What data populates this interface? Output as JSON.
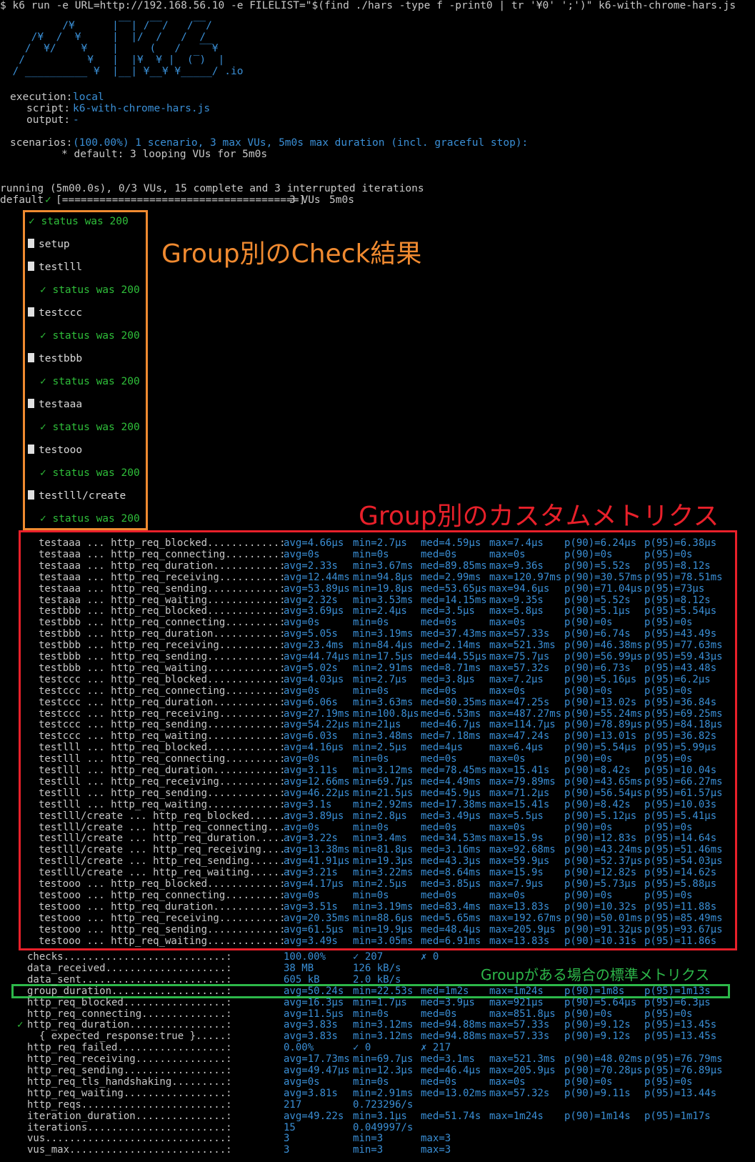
{
  "command": "$ k6 run -e URL=http://192.168.56.10 -e FILELIST=\"$(find ./hars -type f -print0 | tr '¥0' ';')\" k6-with-chrome-hars.js",
  "logo": [
    "          /¥      |‾‾| /‾‾/   /‾‾/",
    "     /¥  /  ¥     |  |/  /   /  /",
    "    /  ¥/    ¥    |     (   /   ‾‾¥",
    "   /          ¥   |  |¥  ¥ |  (‾)  |",
    "  / __________ ¥  |__| ¥__¥ ¥_____/ .io"
  ],
  "execution": {
    "label": "execution:",
    "value": "local"
  },
  "script": {
    "label": "script:",
    "value": "k6-with-chrome-hars.js"
  },
  "output": {
    "label": "output:",
    "value": "-"
  },
  "scenarios": {
    "label": "scenarios:",
    "value": "(100.00%) 1 scenario, 3 max VUs, 5m0s max duration (incl. graceful stop):",
    "detail": "* default: 3 looping VUs for 5m0s"
  },
  "running": "running (5m00.0s), 0/3 VUs, 15 complete and 3 interrupted iterations",
  "progress": {
    "name": "default",
    "check": "✓",
    "bar": "[======================================]",
    "vus": "3 VUs",
    "time": "5m0s"
  },
  "groups": [
    {
      "type": "check",
      "text": "✓ status was 200"
    },
    {
      "type": "group",
      "text": "setup"
    },
    {
      "type": "group",
      "text": "testlll"
    },
    {
      "type": "check",
      "text": "✓ status was 200"
    },
    {
      "type": "group",
      "text": "testccc"
    },
    {
      "type": "check",
      "text": "✓ status was 200"
    },
    {
      "type": "group",
      "text": "testbbb"
    },
    {
      "type": "check",
      "text": "✓ status was 200"
    },
    {
      "type": "group",
      "text": "testaaa"
    },
    {
      "type": "check",
      "text": "✓ status was 200"
    },
    {
      "type": "group",
      "text": "testooo"
    },
    {
      "type": "check",
      "text": "✓ status was 200"
    },
    {
      "type": "group",
      "text": "testlll/create"
    },
    {
      "type": "check",
      "text": "✓ status was 200"
    }
  ],
  "annotations": {
    "checks": {
      "text": "Group別のCheck結果",
      "color": "#f08a30"
    },
    "custom": {
      "text": "Group別のカスタムメトリクス",
      "color": "#e8202a"
    },
    "standard": {
      "text": "Groupがある場合の標準メトリクス",
      "color": "#2db84a"
    }
  },
  "custom_metrics": [
    {
      "name": "testaaa ... http_req_blocked............:",
      "avg": "avg=4.66µs",
      "min": "min=2.7µs",
      "med": "med=4.59µs",
      "max": "max=7.4µs",
      "p90": "p(90)=6.24µs",
      "p95": "p(95)=6.38µs"
    },
    {
      "name": "testaaa ... http_req_connecting.........:",
      "avg": "avg=0s",
      "min": "min=0s",
      "med": "med=0s",
      "max": "max=0s",
      "p90": "p(90)=0s",
      "p95": "p(95)=0s"
    },
    {
      "name": "testaaa ... http_req_duration...........:",
      "avg": "avg=2.33s",
      "min": "min=3.67ms",
      "med": "med=89.85ms",
      "max": "max=9.36s",
      "p90": "p(90)=5.52s",
      "p95": "p(95)=8.12s"
    },
    {
      "name": "testaaa ... http_req_receiving..........:",
      "avg": "avg=12.44ms",
      "min": "min=94.8µs",
      "med": "med=2.99ms",
      "max": "max=120.97ms",
      "p90": "p(90)=30.57ms",
      "p95": "p(95)=78.51ms"
    },
    {
      "name": "testaaa ... http_req_sending............:",
      "avg": "avg=53.89µs",
      "min": "min=19.8µs",
      "med": "med=53.65µs",
      "max": "max=94.6µs",
      "p90": "p(90)=71.04µs",
      "p95": "p(95)=73µs"
    },
    {
      "name": "testaaa ... http_req_waiting............:",
      "avg": "avg=2.32s",
      "min": "min=3.53ms",
      "med": "med=14.15ms",
      "max": "max=9.35s",
      "p90": "p(90)=5.52s",
      "p95": "p(95)=8.12s"
    },
    {
      "name": "testbbb ... http_req_blocked............:",
      "avg": "avg=3.69µs",
      "min": "min=2.4µs",
      "med": "med=3.5µs",
      "max": "max=5.8µs",
      "p90": "p(90)=5.1µs",
      "p95": "p(95)=5.54µs"
    },
    {
      "name": "testbbb ... http_req_connecting.........:",
      "avg": "avg=0s",
      "min": "min=0s",
      "med": "med=0s",
      "max": "max=0s",
      "p90": "p(90)=0s",
      "p95": "p(95)=0s"
    },
    {
      "name": "testbbb ... http_req_duration...........:",
      "avg": "avg=5.05s",
      "min": "min=3.19ms",
      "med": "med=37.43ms",
      "max": "max=57.33s",
      "p90": "p(90)=6.74s",
      "p95": "p(95)=43.49s"
    },
    {
      "name": "testbbb ... http_req_receiving..........:",
      "avg": "avg=23.4ms",
      "min": "min=84.4µs",
      "med": "med=2.14ms",
      "max": "max=521.3ms",
      "p90": "p(90)=46.38ms",
      "p95": "p(95)=77.63ms"
    },
    {
      "name": "testbbb ... http_req_sending............:",
      "avg": "avg=44.74µs",
      "min": "min=17.5µs",
      "med": "med=44.55µs",
      "max": "max=75.7µs",
      "p90": "p(90)=56.99µs",
      "p95": "p(95)=59.43µs"
    },
    {
      "name": "testbbb ... http_req_waiting............:",
      "avg": "avg=5.02s",
      "min": "min=2.91ms",
      "med": "med=8.71ms",
      "max": "max=57.32s",
      "p90": "p(90)=6.73s",
      "p95": "p(95)=43.48s"
    },
    {
      "name": "testccc ... http_req_blocked............:",
      "avg": "avg=4.03µs",
      "min": "min=2.7µs",
      "med": "med=3.8µs",
      "max": "max=7.2µs",
      "p90": "p(90)=5.16µs",
      "p95": "p(95)=6.2µs"
    },
    {
      "name": "testccc ... http_req_connecting.........:",
      "avg": "avg=0s",
      "min": "min=0s",
      "med": "med=0s",
      "max": "max=0s",
      "p90": "p(90)=0s",
      "p95": "p(95)=0s"
    },
    {
      "name": "testccc ... http_req_duration...........:",
      "avg": "avg=6.06s",
      "min": "min=3.63ms",
      "med": "med=80.35ms",
      "max": "max=47.25s",
      "p90": "p(90)=13.02s",
      "p95": "p(95)=36.84s"
    },
    {
      "name": "testccc ... http_req_receiving..........:",
      "avg": "avg=27.19ms",
      "min": "min=100.8µs",
      "med": "med=6.53ms",
      "max": "max=487.27ms",
      "p90": "p(90)=55.24ms",
      "p95": "p(95)=69.25ms"
    },
    {
      "name": "testccc ... http_req_sending............:",
      "avg": "avg=54.22µs",
      "min": "min=21µs",
      "med": "med=46.7µs",
      "max": "max=114.7µs",
      "p90": "p(90)=78.89µs",
      "p95": "p(95)=84.18µs"
    },
    {
      "name": "testccc ... http_req_waiting............:",
      "avg": "avg=6.03s",
      "min": "min=3.48ms",
      "med": "med=7.18ms",
      "max": "max=47.24s",
      "p90": "p(90)=13.01s",
      "p95": "p(95)=36.82s"
    },
    {
      "name": "testlll ... http_req_blocked............:",
      "avg": "avg=4.16µs",
      "min": "min=2.5µs",
      "med": "med=4µs",
      "max": "max=6.4µs",
      "p90": "p(90)=5.54µs",
      "p95": "p(95)=5.99µs"
    },
    {
      "name": "testlll ... http_req_connecting.........:",
      "avg": "avg=0s",
      "min": "min=0s",
      "med": "med=0s",
      "max": "max=0s",
      "p90": "p(90)=0s",
      "p95": "p(95)=0s"
    },
    {
      "name": "testlll ... http_req_duration...........:",
      "avg": "avg=3.11s",
      "min": "min=3.12ms",
      "med": "med=78.45ms",
      "max": "max=15.41s",
      "p90": "p(90)=8.42s",
      "p95": "p(95)=10.04s"
    },
    {
      "name": "testlll ... http_req_receiving..........:",
      "avg": "avg=12.66ms",
      "min": "min=69.7µs",
      "med": "med=4.49ms",
      "max": "max=79.89ms",
      "p90": "p(90)=43.65ms",
      "p95": "p(95)=66.27ms"
    },
    {
      "name": "testlll ... http_req_sending............:",
      "avg": "avg=46.22µs",
      "min": "min=21.5µs",
      "med": "med=45.9µs",
      "max": "max=71.2µs",
      "p90": "p(90)=56.54µs",
      "p95": "p(95)=61.57µs"
    },
    {
      "name": "testlll ... http_req_waiting............:",
      "avg": "avg=3.1s",
      "min": "min=2.92ms",
      "med": "med=17.38ms",
      "max": "max=15.41s",
      "p90": "p(90)=8.42s",
      "p95": "p(95)=10.03s"
    },
    {
      "name": "testlll/create ... http_req_blocked......:",
      "avg": "avg=3.89µs",
      "min": "min=2.8µs",
      "med": "med=3.49µs",
      "max": "max=5.5µs",
      "p90": "p(90)=5.12µs",
      "p95": "p(95)=5.41µs"
    },
    {
      "name": "testlll/create ... http_req_connecting...:",
      "avg": "avg=0s",
      "min": "min=0s",
      "med": "med=0s",
      "max": "max=0s",
      "p90": "p(90)=0s",
      "p95": "p(95)=0s"
    },
    {
      "name": "testlll/create ... http_req_duration.....:",
      "avg": "avg=3.22s",
      "min": "min=3.4ms",
      "med": "med=34.53ms",
      "max": "max=15.9s",
      "p90": "p(90)=12.83s",
      "p95": "p(95)=14.64s"
    },
    {
      "name": "testlll/create ... http_req_receiving....:",
      "avg": "avg=13.38ms",
      "min": "min=81.8µs",
      "med": "med=3.16ms",
      "max": "max=92.68ms",
      "p90": "p(90)=43.24ms",
      "p95": "p(95)=51.46ms"
    },
    {
      "name": "testlll/create ... http_req_sending......:",
      "avg": "avg=41.91µs",
      "min": "min=19.3µs",
      "med": "med=43.3µs",
      "max": "max=59.9µs",
      "p90": "p(90)=52.37µs",
      "p95": "p(95)=54.03µs"
    },
    {
      "name": "testlll/create ... http_req_waiting......:",
      "avg": "avg=3.21s",
      "min": "min=3.22ms",
      "med": "med=8.64ms",
      "max": "max=15.9s",
      "p90": "p(90)=12.82s",
      "p95": "p(95)=14.62s"
    },
    {
      "name": "testooo ... http_req_blocked............:",
      "avg": "avg=4.17µs",
      "min": "min=2.5µs",
      "med": "med=3.85µs",
      "max": "max=7.9µs",
      "p90": "p(90)=5.73µs",
      "p95": "p(95)=5.88µs"
    },
    {
      "name": "testooo ... http_req_connecting.........:",
      "avg": "avg=0s",
      "min": "min=0s",
      "med": "med=0s",
      "max": "max=0s",
      "p90": "p(90)=0s",
      "p95": "p(95)=0s"
    },
    {
      "name": "testooo ... http_req_duration...........:",
      "avg": "avg=3.51s",
      "min": "min=3.19ms",
      "med": "med=83.4ms",
      "max": "max=13.83s",
      "p90": "p(90)=10.32s",
      "p95": "p(95)=11.88s"
    },
    {
      "name": "testooo ... http_req_receiving..........:",
      "avg": "avg=20.35ms",
      "min": "min=88.6µs",
      "med": "med=5.65ms",
      "max": "max=192.67ms",
      "p90": "p(90)=50.01ms",
      "p95": "p(95)=85.49ms"
    },
    {
      "name": "testooo ... http_req_sending............:",
      "avg": "avg=61.5µs",
      "min": "min=19.9µs",
      "med": "med=48.4µs",
      "max": "max=205.9µs",
      "p90": "p(90)=91.32µs",
      "p95": "p(95)=93.67µs"
    },
    {
      "name": "testooo ... http_req_waiting............:",
      "avg": "avg=3.49s",
      "min": "min=3.05ms",
      "med": "med=6.91ms",
      "max": "max=13.83s",
      "p90": "p(90)=10.31s",
      "p95": "p(95)=11.86s"
    }
  ],
  "standard_metrics": [
    {
      "name": "checks...........................:",
      "avg": "100.00%",
      "min": "✓ 207",
      "med": "✗ 0"
    },
    {
      "name": "data_received....................:",
      "avg": "38 MB",
      "min": "126 kB/s"
    },
    {
      "name": "data_sent........................:",
      "avg": "605 kB",
      "min": "2.0 kB/s"
    },
    {
      "name": "group_duration...................:",
      "avg": "avg=50.24s",
      "min": "min=22.53s",
      "med": "med=1m2s",
      "max": "max=1m24s",
      "p90": "p(90)=1m8s",
      "p95": "p(95)=1m13s"
    },
    {
      "name": "http_req_blocked.................:",
      "avg": "avg=16.3µs",
      "min": "min=1.7µs",
      "med": "med=3.9µs",
      "max": "max=921µs",
      "p90": "p(90)=5.64µs",
      "p95": "p(95)=6.3µs"
    },
    {
      "name": "http_req_connecting..............:",
      "avg": "avg=11.5µs",
      "min": "min=0s",
      "med": "med=0s",
      "max": "max=851.8µs",
      "p90": "p(90)=0s",
      "p95": "p(95)=0s"
    },
    {
      "mark": "✓",
      "name": "http_req_duration................:",
      "avg": "avg=3.83s",
      "min": "min=3.12ms",
      "med": "med=94.88ms",
      "max": "max=57.33s",
      "p90": "p(90)=9.12s",
      "p95": "p(95)=13.45s"
    },
    {
      "name": "  { expected_response:true }.....:",
      "avg": "avg=3.83s",
      "min": "min=3.12ms",
      "med": "med=94.88ms",
      "max": "max=57.33s",
      "p90": "p(90)=9.12s",
      "p95": "p(95)=13.45s"
    },
    {
      "name": "http_req_failed..................:",
      "avg": "0.00%",
      "min": "✓ 0",
      "med": "✗ 217"
    },
    {
      "name": "http_req_receiving...............:",
      "avg": "avg=17.73ms",
      "min": "min=69.7µs",
      "med": "med=3.1ms",
      "max": "max=521.3ms",
      "p90": "p(90)=48.02ms",
      "p95": "p(95)=76.79ms"
    },
    {
      "name": "http_req_sending.................:",
      "avg": "avg=49.47µs",
      "min": "min=12.3µs",
      "med": "med=46.4µs",
      "max": "max=205.9µs",
      "p90": "p(90)=70.28µs",
      "p95": "p(95)=76.89µs"
    },
    {
      "name": "http_req_tls_handshaking.........:",
      "avg": "avg=0s",
      "min": "min=0s",
      "med": "med=0s",
      "max": "max=0s",
      "p90": "p(90)=0s",
      "p95": "p(95)=0s"
    },
    {
      "name": "http_req_waiting.................:",
      "avg": "avg=3.81s",
      "min": "min=2.91ms",
      "med": "med=13.02ms",
      "max": "max=57.32s",
      "p90": "p(90)=9.11s",
      "p95": "p(95)=13.44s"
    },
    {
      "name": "http_reqs........................:",
      "avg": "217",
      "min": "0.723296/s"
    },
    {
      "name": "iteration_duration...............:",
      "avg": "avg=49.22s",
      "min": "min=3.1µs",
      "med": "med=51.74s",
      "max": "max=1m24s",
      "p90": "p(90)=1m14s",
      "p95": "p(95)=1m17s"
    },
    {
      "name": "iterations.......................:",
      "avg": "15",
      "min": "0.049997/s"
    },
    {
      "name": "vus..............................:",
      "avg": "3",
      "min": "min=3",
      "med": "max=3"
    },
    {
      "name": "vus_max..........................:",
      "avg": "3",
      "min": "min=3",
      "med": "max=3"
    }
  ]
}
